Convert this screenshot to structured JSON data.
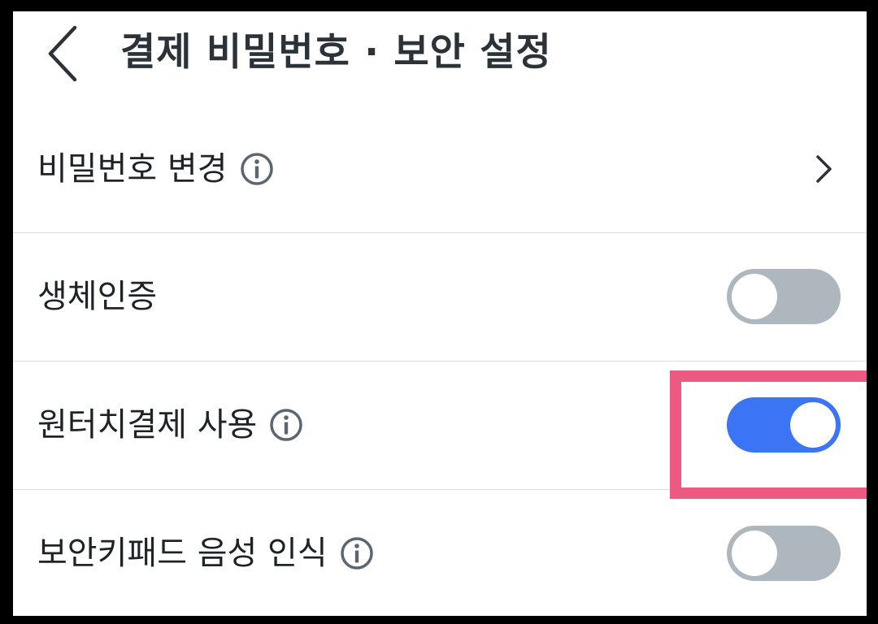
{
  "header": {
    "title": "결제 비밀번호 · 보안 설정",
    "back_icon": "chevron-left-icon"
  },
  "rows": [
    {
      "label": "비밀번호 변경",
      "has_info": true,
      "control": "chevron",
      "icon": "chevron-right-icon"
    },
    {
      "label": "생체인증",
      "has_info": false,
      "control": "toggle",
      "enabled": false
    },
    {
      "label": "원터치결제 사용",
      "has_info": true,
      "control": "toggle",
      "enabled": true
    },
    {
      "label": "보안키패드 음성 인식",
      "has_info": true,
      "control": "toggle",
      "enabled": false
    }
  ],
  "colors": {
    "title_text": "#2b3238",
    "label_text": "#1f2326",
    "icon_gray": "#5b6670",
    "divider": "#d9dde1",
    "toggle_on": "#3b74f5",
    "toggle_off": "#aeb6be",
    "highlight": "#ec5a82",
    "background": "#ffffff",
    "frame": "#000000"
  }
}
